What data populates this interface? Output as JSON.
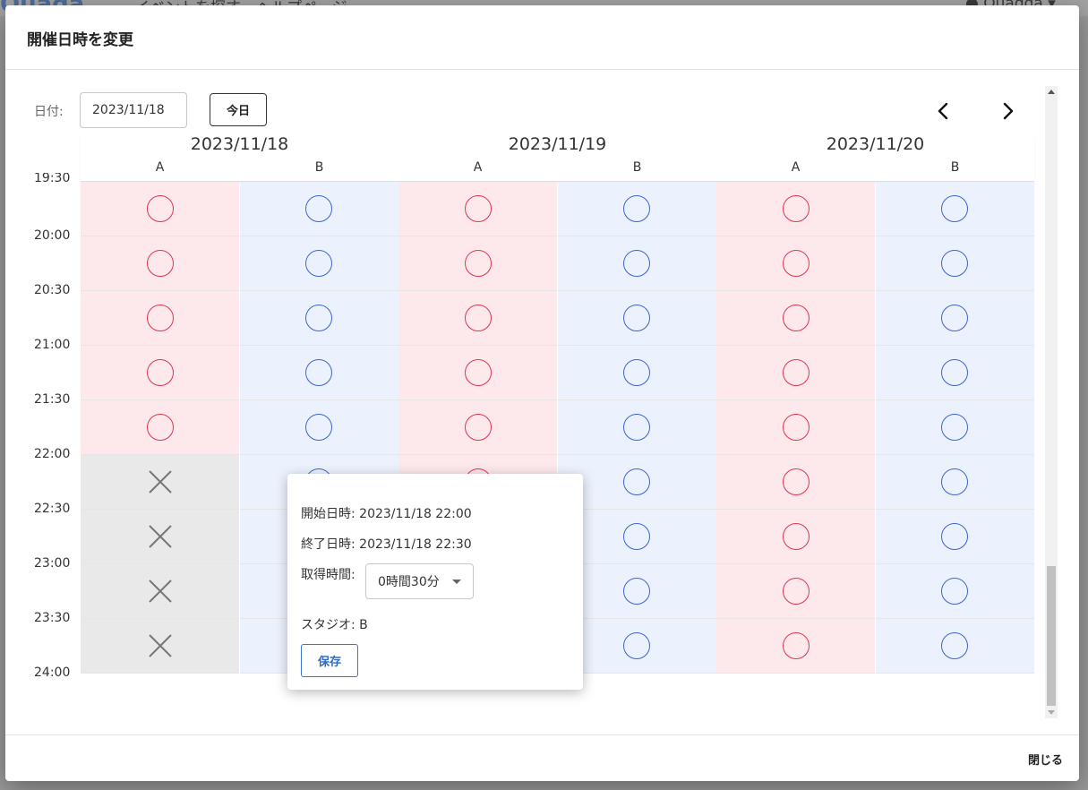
{
  "background": {
    "nav_text": "イベントを探す　ヘルプページ",
    "user_name": "Quagga",
    "logo": "Quaga"
  },
  "modal": {
    "title": "開催日時を変更",
    "close_label": "閉じる"
  },
  "toolbar": {
    "date_label": "日付:",
    "date_value": "2023/11/18",
    "today_label": "今日",
    "prev_icon": "chevron-left-icon",
    "next_icon": "chevron-right-icon"
  },
  "calendar": {
    "days": [
      {
        "date": "2023/11/18",
        "studios": [
          "A",
          "B"
        ]
      },
      {
        "date": "2023/11/19",
        "studios": [
          "A",
          "B"
        ]
      },
      {
        "date": "2023/11/20",
        "studios": [
          "A",
          "B"
        ]
      }
    ],
    "time_labels": [
      "19:30",
      "20:00",
      "20:30",
      "21:00",
      "21:30",
      "22:00",
      "22:30",
      "23:00",
      "23:30",
      "24:00"
    ],
    "columns": [
      {
        "studio": "A",
        "slots": [
          "○",
          "○",
          "○",
          "○",
          "○",
          "×",
          "×",
          "×",
          "×"
        ]
      },
      {
        "studio": "B",
        "slots": [
          "○",
          "○",
          "○",
          "○",
          "○",
          "○",
          "○",
          "○",
          "○"
        ]
      },
      {
        "studio": "A",
        "slots": [
          "○",
          "○",
          "○",
          "○",
          "○",
          "○",
          "○",
          "○",
          "○"
        ]
      },
      {
        "studio": "B",
        "slots": [
          "○",
          "○",
          "○",
          "○",
          "○",
          "○",
          "○",
          "○",
          "○"
        ]
      },
      {
        "studio": "A",
        "slots": [
          "○",
          "○",
          "○",
          "○",
          "○",
          "○",
          "○",
          "○",
          "○"
        ]
      },
      {
        "studio": "B",
        "slots": [
          "○",
          "○",
          "○",
          "○",
          "○",
          "○",
          "○",
          "○",
          "○"
        ]
      }
    ],
    "colors": {
      "studio_a_bg": "#fde8ec",
      "studio_b_bg": "#ecf2fd",
      "available_a": "#e0364f",
      "available_b": "#3e63d2",
      "closed_bg": "#e9e9e9"
    }
  },
  "popover": {
    "start": "開始日時: 2023/11/18 22:00",
    "end": "終了日時: 2023/11/18 22:30",
    "duration_label": "取得時間:",
    "duration_value": "0時間30分",
    "studio": "スタジオ: B",
    "save_label": "保存"
  }
}
